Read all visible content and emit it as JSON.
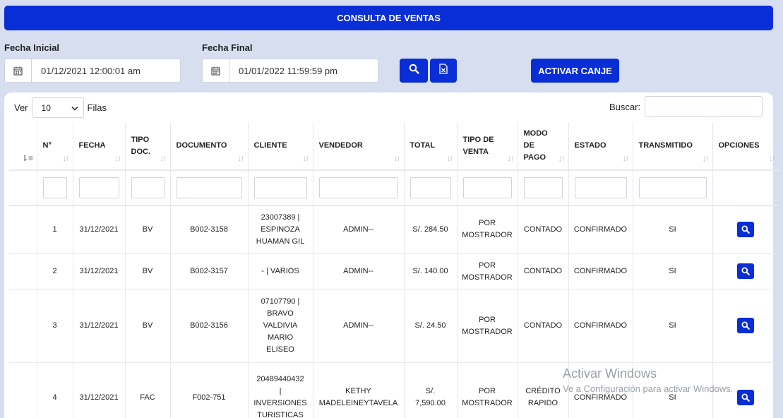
{
  "header": {
    "title": "CONSULTA DE VENTAS"
  },
  "filters": {
    "start_label": "Fecha Inicial",
    "start_value": "01/12/2021 12:00:01 am",
    "end_label": "Fecha Final",
    "end_value": "01/01/2022 11:59:59 pm",
    "activate_label": "ACTIVAR CANJE"
  },
  "list_controls": {
    "show_prefix": "Ver",
    "page_size": "10",
    "show_suffix": "Filas",
    "search_label": "Buscar:"
  },
  "table": {
    "columns": [
      [
        "N°"
      ],
      [
        "FECHA"
      ],
      [
        "TIPO",
        "DOC."
      ],
      [
        "DOCUMENTO"
      ],
      [
        "CLIENTE"
      ],
      [
        "VENDEDOR"
      ],
      [
        "TOTAL"
      ],
      [
        "TIPO DE",
        "VENTA"
      ],
      [
        "MODO",
        "DE",
        "PAGO"
      ],
      [
        "ESTADO"
      ],
      [
        "TRANSMITIDO"
      ],
      [
        "OPCIONES"
      ]
    ],
    "rows": [
      {
        "n": "1",
        "fecha": "31/12/2021",
        "tipo_doc": "BV",
        "documento": "B002-3158",
        "cliente": [
          "23007389 |",
          "ESPINOZA",
          "HUAMAN GIL"
        ],
        "vendedor": [
          "ADMIN--"
        ],
        "total": [
          "S/. 284.50"
        ],
        "tipo_venta": [
          "POR",
          "MOSTRADOR"
        ],
        "modo_pago": [
          "CONTADO"
        ],
        "estado": "CONFIRMADO",
        "transmitido": "SI"
      },
      {
        "n": "2",
        "fecha": "31/12/2021",
        "tipo_doc": "BV",
        "documento": "B002-3157",
        "cliente": [
          "- | VARIOS"
        ],
        "vendedor": [
          "ADMIN--"
        ],
        "total": [
          "S/. 140.00"
        ],
        "tipo_venta": [
          "POR",
          "MOSTRADOR"
        ],
        "modo_pago": [
          "CONTADO"
        ],
        "estado": "CONFIRMADO",
        "transmitido": "SI"
      },
      {
        "n": "3",
        "fecha": "31/12/2021",
        "tipo_doc": "BV",
        "documento": "B002-3156",
        "cliente": [
          "07107790 |",
          "BRAVO",
          "VALDIVIA",
          "MARIO",
          "ELISEO"
        ],
        "vendedor": [
          "ADMIN--"
        ],
        "total": [
          "S/. 24.50"
        ],
        "tipo_venta": [
          "POR",
          "MOSTRADOR"
        ],
        "modo_pago": [
          "CONTADO"
        ],
        "estado": "CONFIRMADO",
        "transmitido": "SI"
      },
      {
        "n": "4",
        "fecha": "31/12/2021",
        "tipo_doc": "FAC",
        "documento": "F002-751",
        "cliente": [
          "20489440432",
          "|",
          "INVERSIONES",
          "TURISTICAS"
        ],
        "vendedor": [
          "KETHY",
          "MADELEINEYTAVELA"
        ],
        "total": [
          "S/.",
          "7,590.00"
        ],
        "tipo_venta": [
          "POR",
          "MOSTRADOR"
        ],
        "modo_pago": [
          "CRÉDITO",
          "RAPIDO"
        ],
        "estado": "CONFIRMADO",
        "transmitido": "SI"
      }
    ]
  },
  "watermark": {
    "line1": "Activar Windows",
    "line2": "Ve a Configuración para activar Windows."
  },
  "colors": {
    "primary": "#0a2ed6",
    "background": "#d6def0"
  },
  "icons": {
    "date_icon": "calendar-icon",
    "search_button_icon": "search-icon",
    "export_button_icon": "excel-icon",
    "row_action_icon": "search-icon",
    "sort_icon": "sort-arrows-icon",
    "select_icon": "chevron-down-icon"
  }
}
